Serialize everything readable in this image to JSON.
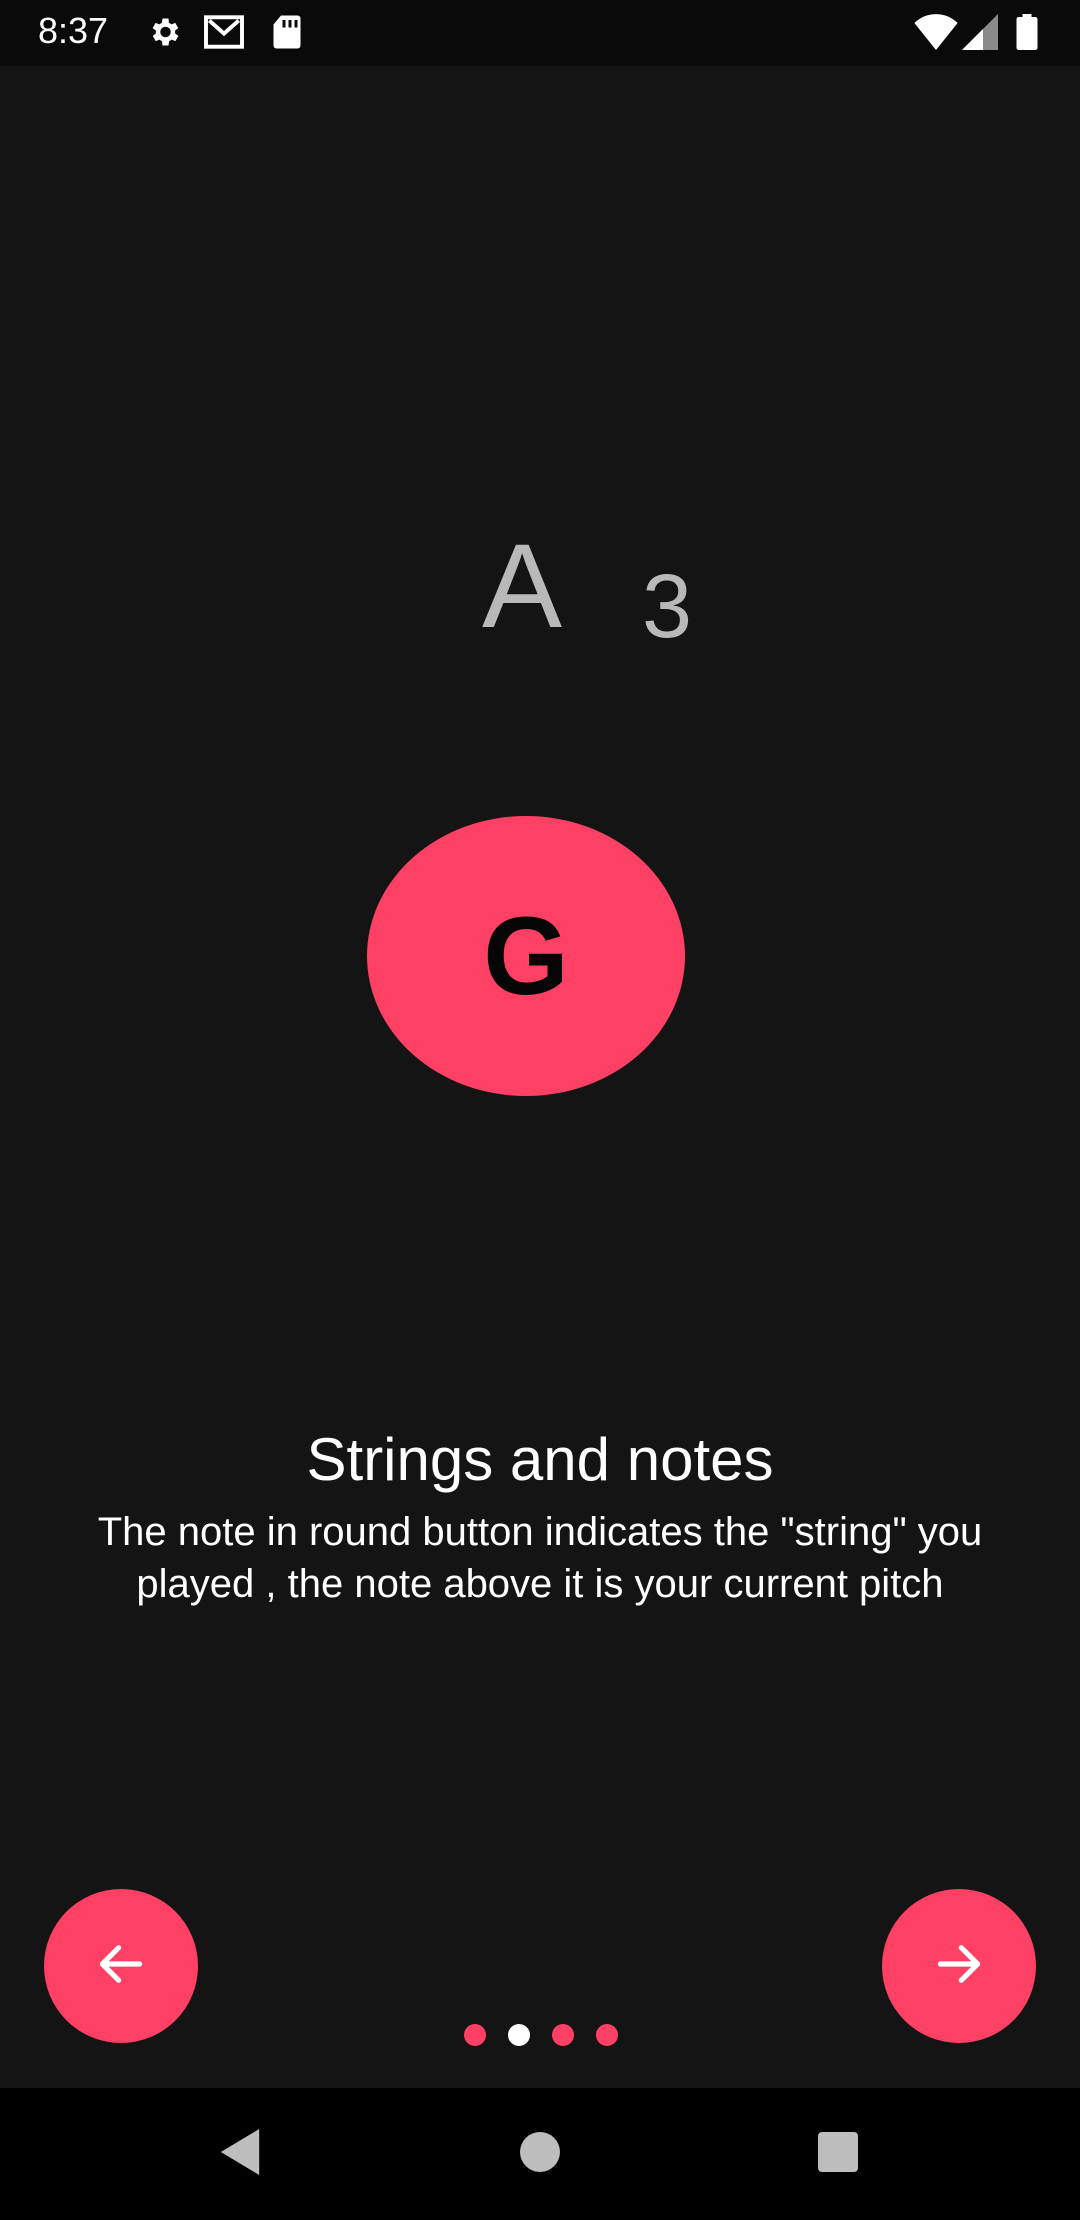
{
  "status_bar": {
    "time": "8:37",
    "icons": [
      "gear-icon",
      "gmail-icon",
      "sd-card-icon",
      "wifi-icon",
      "signal-icon",
      "battery-icon"
    ]
  },
  "tuner": {
    "pitch_note": "A",
    "pitch_octave": "3",
    "string_button_label": "G"
  },
  "onboarding": {
    "title": "Strings and notes",
    "description": "The note in round button indicates the \"string\" you played , the note above it is your current pitch",
    "page_count": 4,
    "current_page": 2
  },
  "colors": {
    "accent": "#ff4065",
    "background": "#141414",
    "pitch_text": "#b9b9b9",
    "dot_inactive": "#ff4065",
    "dot_active": "#ffffff"
  },
  "navigation_bar": {
    "icons": [
      "back-triangle-icon",
      "home-circle-icon",
      "recents-square-icon"
    ]
  }
}
